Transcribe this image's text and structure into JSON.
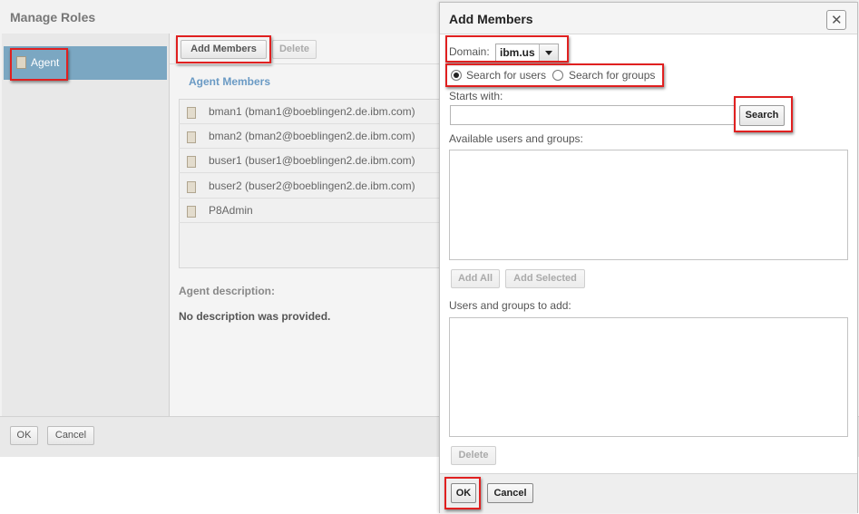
{
  "manage_roles": {
    "title": "Manage Roles",
    "sidebar": {
      "items": [
        {
          "label": "Agent",
          "icon": "role-icon"
        }
      ]
    },
    "toolbar": {
      "add_members": "Add Members",
      "delete": "Delete"
    },
    "members_title": "Agent Members",
    "members": [
      "bman1 (bman1@boeblingen2.de.ibm.com)",
      "bman2 (bman2@boeblingen2.de.ibm.com)",
      "buser1 (buser1@boeblingen2.de.ibm.com)",
      "buser2 (buser2@boeblingen2.de.ibm.com)",
      "P8Admin"
    ],
    "description_label": "Agent description:",
    "description_text": "No description was provided.",
    "footer": {
      "ok": "OK",
      "cancel": "Cancel"
    }
  },
  "add_members": {
    "title": "Add Members",
    "close_icon": "close-icon",
    "domain_label": "Domain:",
    "domain_value": "ibm.us",
    "search_users_label": "Search for users",
    "search_groups_label": "Search for groups",
    "search_mode": "users",
    "starts_with_label": "Starts with:",
    "starts_with_value": "",
    "search_button": "Search",
    "available_label": "Available users and groups:",
    "add_all": "Add All",
    "add_selected": "Add Selected",
    "to_add_label": "Users and groups to add:",
    "delete": "Delete",
    "ok": "OK",
    "cancel": "Cancel"
  },
  "colors": {
    "highlight": "#e02020",
    "sidebar_selected": "#7ba7c2",
    "link": "#6a9ac4"
  }
}
